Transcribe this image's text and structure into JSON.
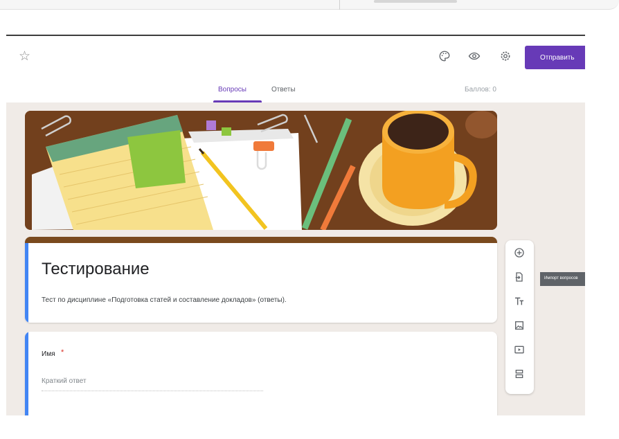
{
  "toolbar": {
    "send_label": "Отправить"
  },
  "tabs": [
    {
      "label": "Вопросы",
      "active": true
    },
    {
      "label": "Ответы",
      "active": false
    }
  ],
  "points_label": "Баллов: 0",
  "form": {
    "title": "Тестирование",
    "description": "Тест по дисциплине «Подготовка статей и составление докладов» (ответы)."
  },
  "question": {
    "label": "Имя",
    "required_mark": "*",
    "answer_placeholder": "Краткий ответ"
  },
  "side_panel": {
    "tooltip": "Импорт вопросов"
  },
  "colors": {
    "accent": "#673ab7",
    "header_brown": "#7a4a1e",
    "focus_blue": "#4285f4",
    "canvas_bg": "#f0ebe7"
  },
  "icons": {
    "star": "star-icon",
    "palette": "palette-icon",
    "preview": "eye-icon",
    "settings": "gear-icon",
    "add_question": "plus-circle-icon",
    "import_questions": "import-icon",
    "add_title": "text-title-icon",
    "add_image": "image-icon",
    "add_video": "video-icon",
    "add_section": "section-icon"
  }
}
